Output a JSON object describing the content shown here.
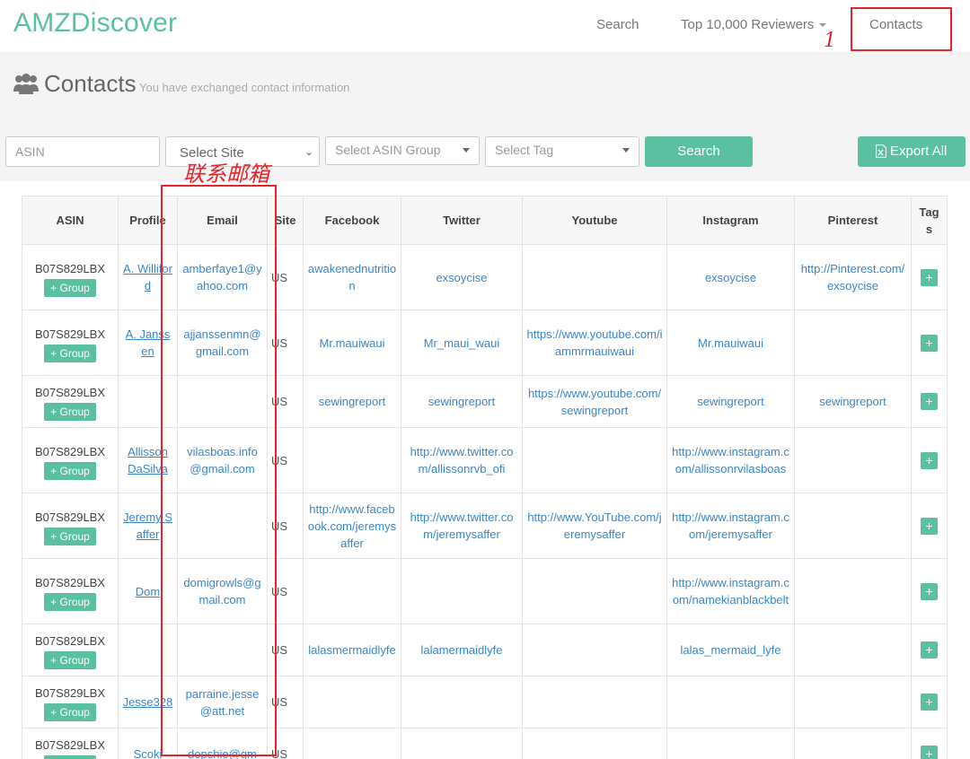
{
  "header": {
    "brand": "AMZDiscover",
    "nav": {
      "search": "Search",
      "top_reviewers": "Top 10,000 Reviewers",
      "contacts": "Contacts"
    },
    "annotation_number": "1"
  },
  "page": {
    "title": "Contacts",
    "subtitle": "You have exchanged contact information"
  },
  "annotation": {
    "email_label": "联系邮箱"
  },
  "filters": {
    "asin_placeholder": "ASIN",
    "site_label": "Select Site",
    "group_label": "Select ASIN Group",
    "tag_label": "Select Tag",
    "search_label": "Search",
    "export_label": "Export All"
  },
  "table": {
    "headers": [
      "ASIN",
      "Profile",
      "Email",
      "Site",
      "Facebook",
      "Twitter",
      "Youtube",
      "Instagram",
      "Pinterest",
      "Tags"
    ],
    "group_label": "+ Group",
    "tag_label": "+",
    "rows": [
      {
        "asin": "B07S829LBX",
        "profile": "A. Williford",
        "email": "amberfaye1@yahoo.com",
        "site": "US",
        "facebook": "awakenednutrition",
        "twitter": "exsoycise",
        "youtube": "",
        "instagram": "exsoycise",
        "pinterest": "http://Pinterest.com/exsoycise",
        "group": true
      },
      {
        "asin": "B07S829LBX",
        "profile": "A. Janssen",
        "email": "ajjanssenmn@gmail.com",
        "site": "US",
        "facebook": "Mr.mauiwaui",
        "twitter": "Mr_maui_waui",
        "youtube": "https://www.youtube.com/iammrmauiwaui",
        "instagram": "Mr.mauiwaui",
        "pinterest": "",
        "group": true
      },
      {
        "asin": "B07S829LBX",
        "profile": "",
        "email": "",
        "site": "US",
        "facebook": "sewingreport",
        "twitter": "sewingreport",
        "youtube": "https://www.youtube.com/sewingreport",
        "instagram": "sewingreport",
        "pinterest": "sewingreport",
        "group": true
      },
      {
        "asin": "B07S829LBX",
        "profile": "Allisson DaSilva",
        "email": "vilasboas.info@gmail.com",
        "site": "US",
        "facebook": "",
        "twitter": "http://www.twitter.com/allissonrvb_ofi",
        "youtube": "",
        "instagram": "http://www.instagram.com/allissonrvilasboas",
        "pinterest": "",
        "group": true
      },
      {
        "asin": "B07S829LBX",
        "profile": "Jeremy Saffer",
        "email": "",
        "site": "US",
        "facebook": "http://www.facebook.com/jeremysaffer",
        "twitter": "http://www.twitter.com/jeremysaffer",
        "youtube": "http://www.YouTube.com/jeremysaffer",
        "instagram": "http://www.instagram.com/jeremysaffer",
        "pinterest": "",
        "group": true
      },
      {
        "asin": "B07S829LBX",
        "profile": "Dom",
        "email": "domigrowls@gmail.com",
        "site": "US",
        "facebook": "",
        "twitter": "",
        "youtube": "",
        "instagram": "http://www.instagram.com/namekianblackbelt",
        "pinterest": "",
        "group": true
      },
      {
        "asin": "B07S829LBX",
        "profile": "",
        "email": "",
        "site": "US",
        "facebook": "lalasmermaidlyfe",
        "twitter": "lalamermaidlyfe",
        "youtube": "",
        "instagram": "lalas_mermaid_lyfe",
        "pinterest": "",
        "group": true
      },
      {
        "asin": "B07S829LBX",
        "profile": "Jesse328",
        "email": "parraine.jesse@att.net",
        "site": "US",
        "facebook": "",
        "twitter": "",
        "youtube": "",
        "instagram": "",
        "pinterest": "",
        "group": true
      },
      {
        "asin": "B07S829LBX",
        "profile": "Scoki",
        "email": "dopshie@gm",
        "site": "US",
        "facebook": "",
        "twitter": "",
        "youtube": "",
        "instagram": "",
        "pinterest": "",
        "group": true
      }
    ]
  },
  "colors": {
    "accent": "#5bc0a1",
    "link": "#3a86c8",
    "annotation": "#e6252a"
  }
}
